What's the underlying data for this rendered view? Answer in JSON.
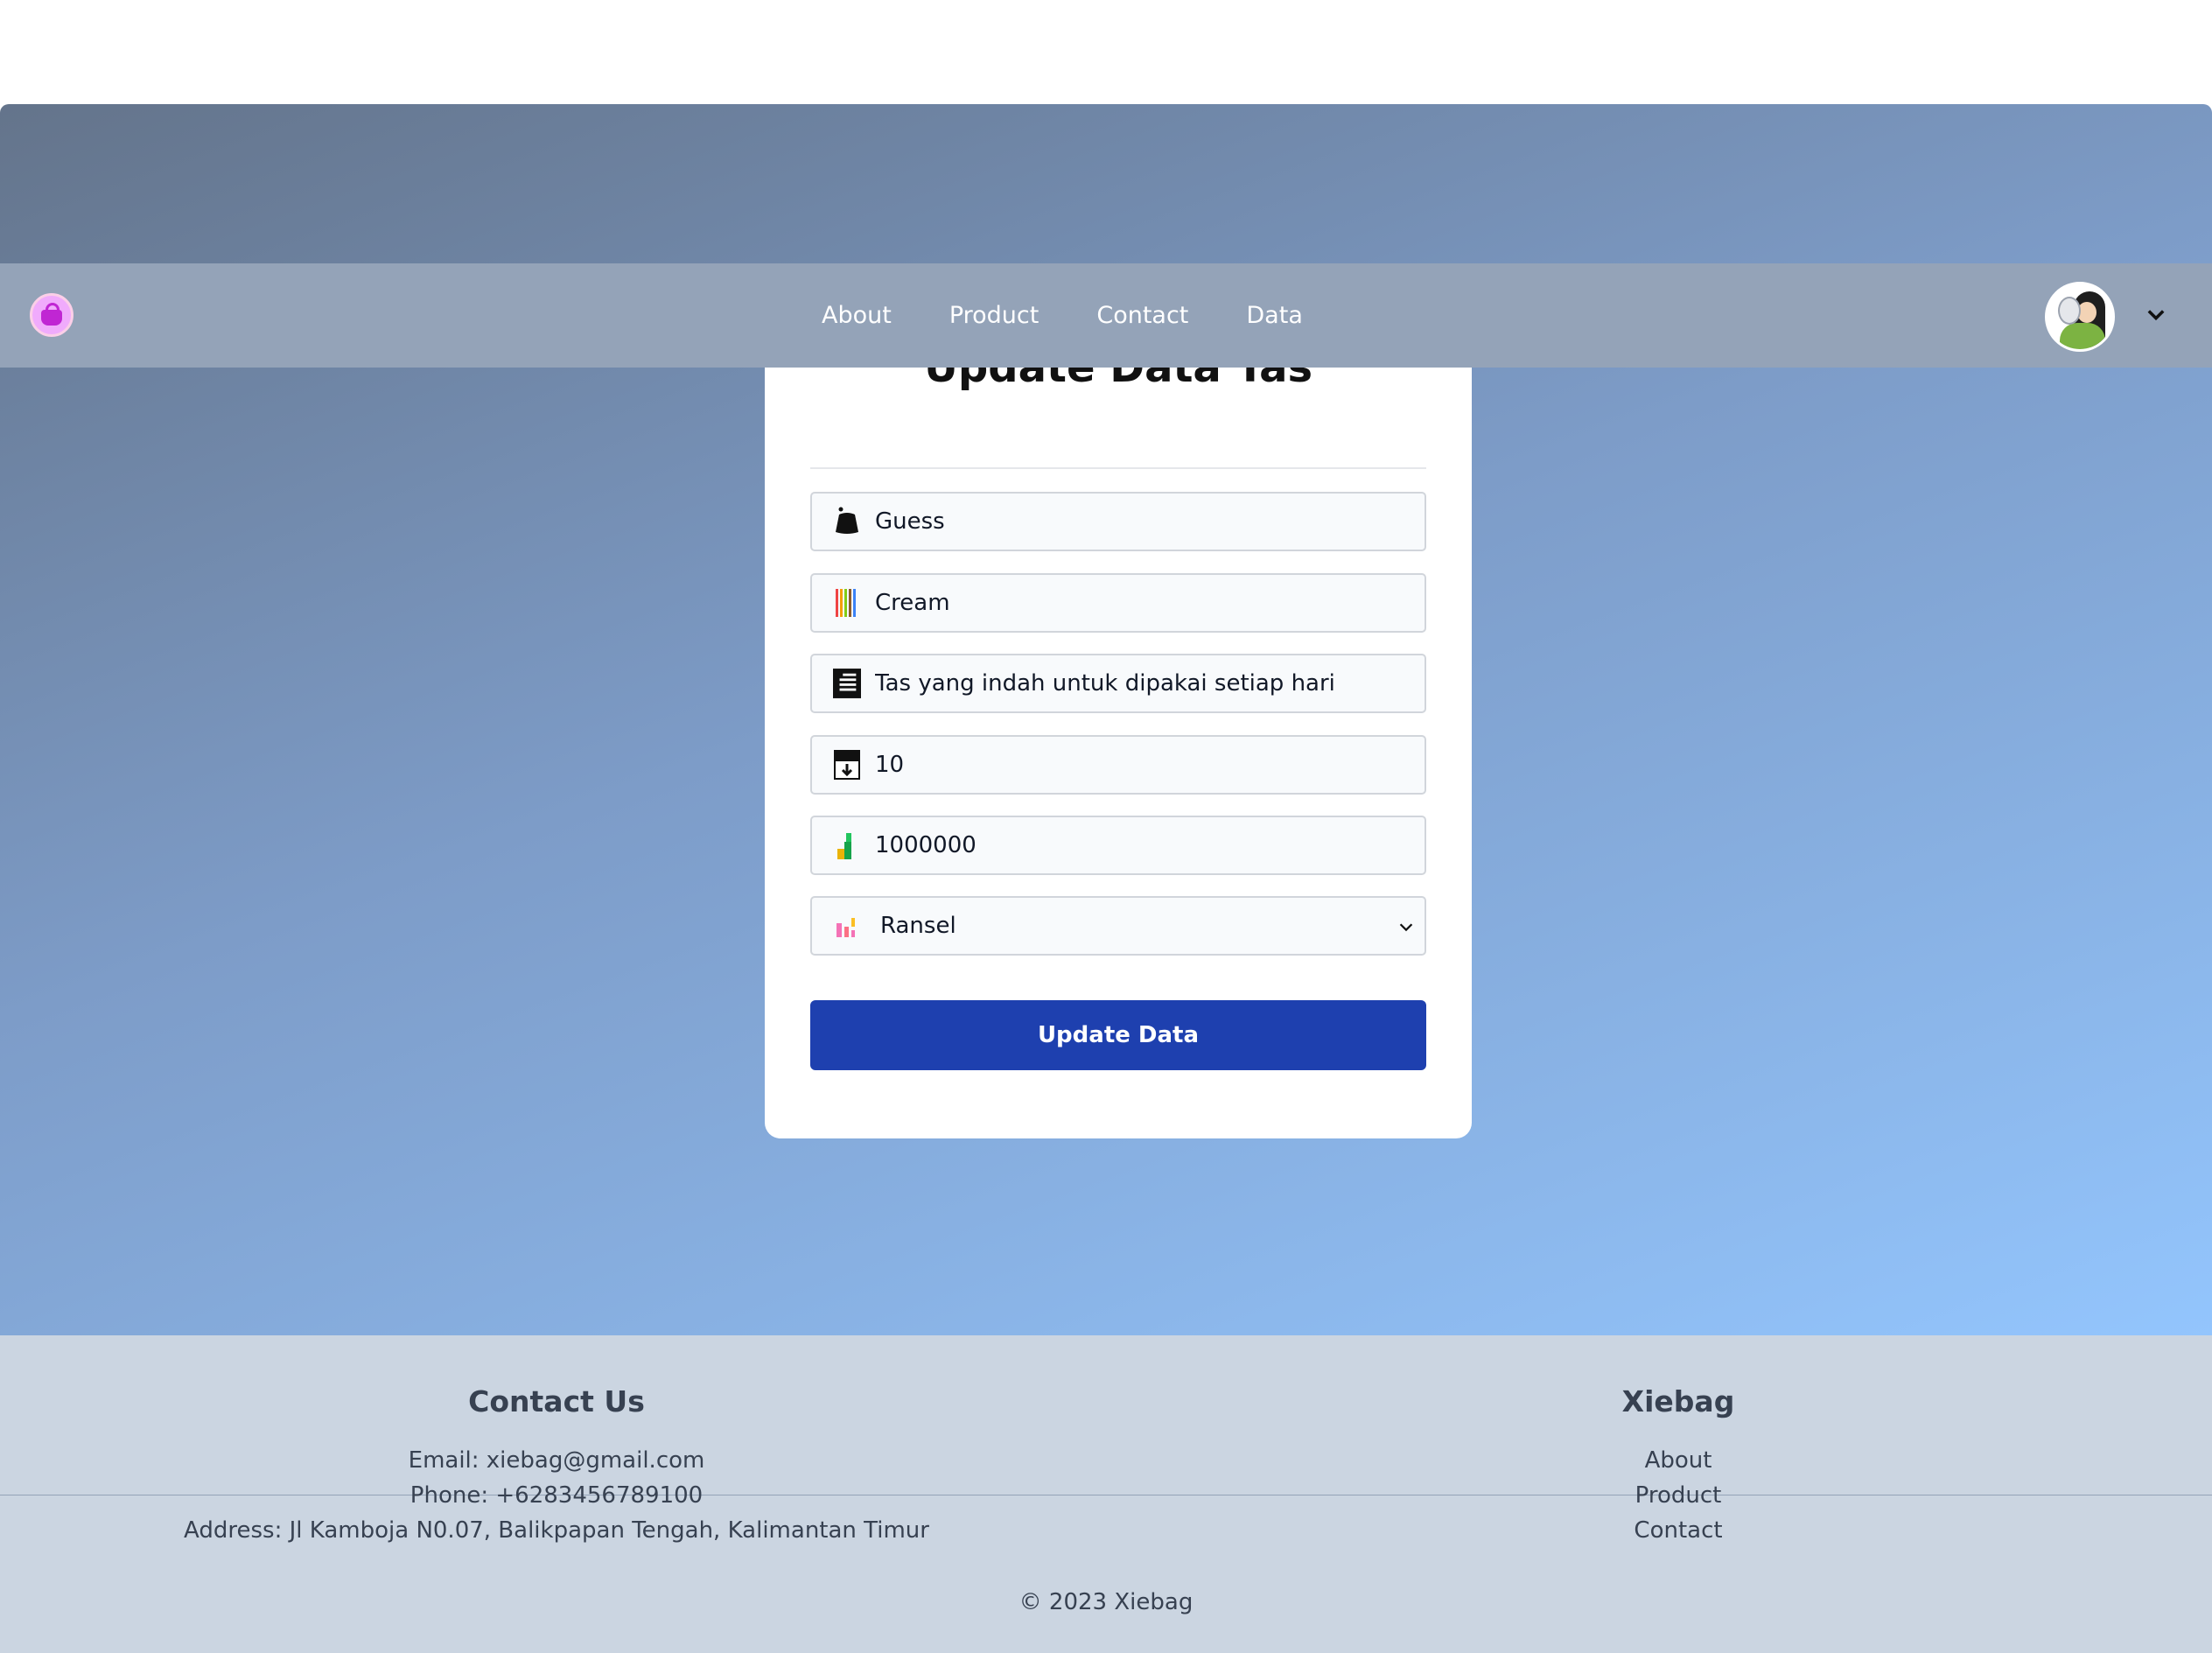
{
  "nav": {
    "links": [
      "About",
      "Product",
      "Contact",
      "Data"
    ],
    "logo_icon": "handbag-logo-icon",
    "avatar": "user-avatar",
    "menu_icon": "chevron-down-icon"
  },
  "form": {
    "title": "Update Data Tas",
    "fields": {
      "brand": {
        "value": "Guess",
        "icon": "bag-icon"
      },
      "color": {
        "value": "Cream",
        "icon": "color-palette-icon"
      },
      "description": {
        "value": "Tas yang indah untuk dipakai setiap hari",
        "icon": "document-icon"
      },
      "stock": {
        "value": "10",
        "icon": "inbox-tray-icon"
      },
      "price": {
        "value": "1000000",
        "icon": "money-icon"
      },
      "category": {
        "value": "Ransel",
        "icon": "bar-chart-icon"
      }
    },
    "submit_label": "Update Data"
  },
  "footer": {
    "contact": {
      "heading": "Contact Us",
      "email": "Email: xiebag@gmail.com",
      "phone": "Phone: +6283456789100",
      "address": "Address: Jl Kamboja N0.07, Balikpapan Tengah, Kalimantan Timur"
    },
    "brand": {
      "heading": "Xiebag",
      "links": [
        "About",
        "Product",
        "Contact"
      ]
    },
    "copyright": "© 2023 Xiebag"
  },
  "colors": {
    "navbar": "#94a3b8",
    "button": "#1e40af",
    "footer": "#cbd5e1"
  }
}
